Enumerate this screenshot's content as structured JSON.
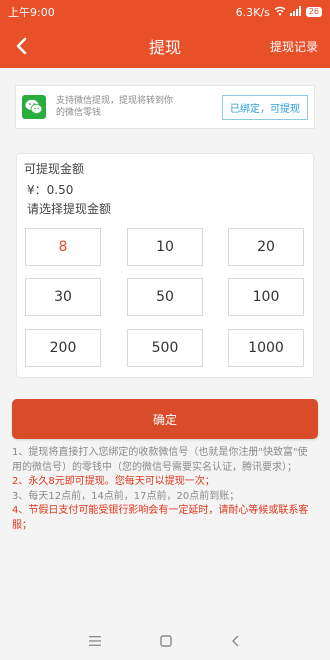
{
  "status_bar": {
    "time": "上午9:00",
    "network_speed": "6.3K/s",
    "battery": "26"
  },
  "nav": {
    "title": "提现",
    "record_link": "提现记录"
  },
  "wechat": {
    "description": "支持微信提现，提现将转到你的微信零钱",
    "bind_status": "已绑定，可提现"
  },
  "amount_card": {
    "available_label": "可提现金额",
    "balance": "¥：0.50",
    "choose_label": "请选择提现金额",
    "options": [
      "8",
      "10",
      "20",
      "30",
      "50",
      "100",
      "200",
      "500",
      "1000"
    ],
    "selected": "8"
  },
  "confirm_label": "确定",
  "notes": [
    "1、提现将直接打入您绑定的收款微信号（也就是你注册\"快致富\"使用的微信号）的零钱中（您的微信号需要实名认证，腾讯要求）；",
    "2、永久8元即可提现。您每天可以提现一次；",
    "3、每天12点前，14点前，17点前，20点前到账；",
    "4、节假日支付可能受银行影响会有一定延时，请耐心等候或联系客服；"
  ],
  "colors": {
    "accent": "#e8502a",
    "confirm": "#d94c2a",
    "note_highlight": "#e0361c",
    "bind_blue": "#2a9fd6",
    "wechat_green": "#2bad3e"
  },
  "icons": [
    "back-arrow-icon",
    "wifi-icon",
    "signal-icon",
    "battery-icon",
    "wechat-icon",
    "menu-icon",
    "home-icon",
    "back-nav-icon"
  ]
}
